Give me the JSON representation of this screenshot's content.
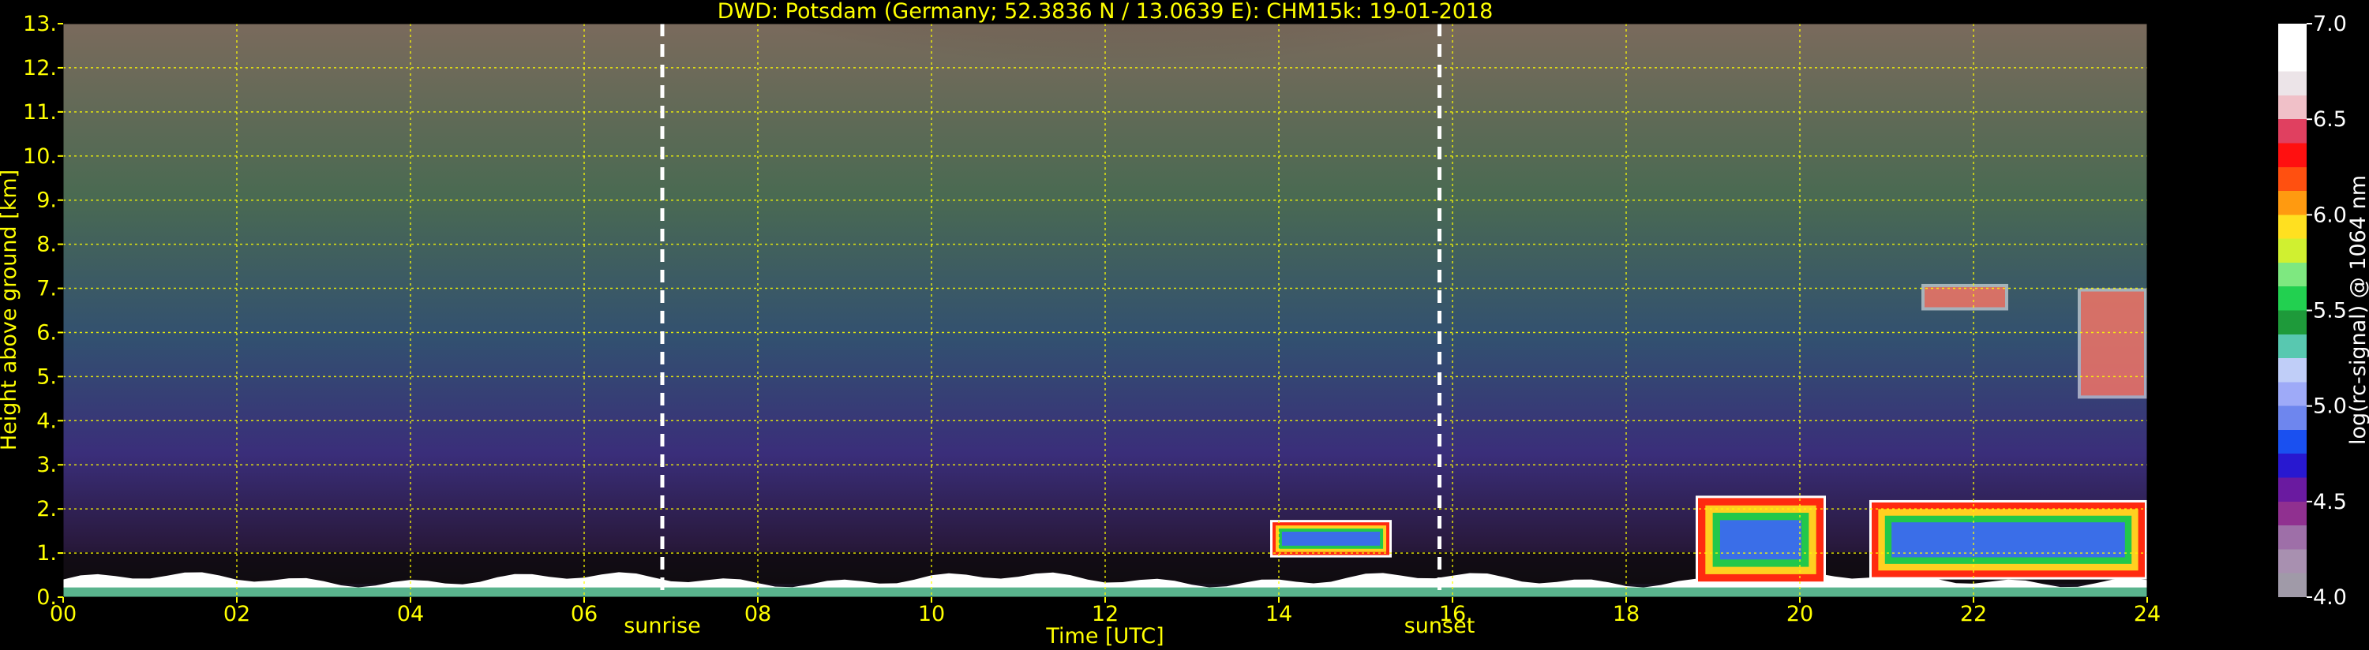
{
  "chart_data": {
    "type": "heatmap",
    "title": "DWD: Potsdam (Germany; 52.3836 N / 13.0639 E):    CHM15k: 19-01-2018",
    "xlabel": "Time [UTC]",
    "ylabel": "Height above ground [km]",
    "xlim": [
      0,
      24
    ],
    "ylim": [
      0,
      13
    ],
    "x_ticks": [
      "00",
      "02",
      "04",
      "06",
      "08",
      "10",
      "12",
      "14",
      "16",
      "18",
      "20",
      "22",
      "24"
    ],
    "y_ticks": [
      "0.",
      "1.",
      "2.",
      "3.",
      "4.",
      "5.",
      "6.",
      "7.",
      "8.",
      "9.",
      "10.",
      "11.",
      "12.",
      "13."
    ],
    "grid": true,
    "grid_color": "#ffff00",
    "markers": [
      {
        "label": "sunrise",
        "time": 6.9
      },
      {
        "label": "sunset",
        "time": 15.85
      }
    ],
    "colorbar": {
      "label": "log(rc-signal) @ 1064 nm",
      "range": [
        4.0,
        7.0
      ],
      "ticks": [
        "4.0",
        "4.5",
        "5.0",
        "5.5",
        "6.0",
        "6.5",
        "7.0"
      ],
      "colors": [
        "#a09aa8",
        "#a890b0",
        "#9e6fa8",
        "#903090",
        "#6a1aa0",
        "#2818d0",
        "#1a50f0",
        "#6e86ee",
        "#9eaaf8",
        "#c0cef8",
        "#58c8b0",
        "#1e9a3a",
        "#22d050",
        "#7ee880",
        "#d0f030",
        "#ffe020",
        "#ff9a10",
        "#ff5010",
        "#ff1010",
        "#e04060",
        "#f0c0c8",
        "#ece4e8",
        "#ffffff",
        "#ffffff"
      ]
    },
    "features": [
      {
        "name": "boundary layer",
        "t": [
          0,
          24
        ],
        "top_km": [
          0.3,
          0.5
        ]
      },
      {
        "name": "cloud",
        "t": [
          13.9,
          15.3
        ],
        "base_km": 0.9,
        "top_km": 1.75
      },
      {
        "name": "cloud",
        "t": [
          18.8,
          20.3
        ],
        "base_km": 0.3,
        "top_km": 2.3
      },
      {
        "name": "cloud",
        "t": [
          20.8,
          24
        ],
        "base_km": 0.4,
        "top_km": 2.2
      },
      {
        "name": "cirrus",
        "t": [
          21.4,
          22.4
        ],
        "base_km": 6.5,
        "top_km": 7.1
      },
      {
        "name": "cirrus",
        "t": [
          23.2,
          24
        ],
        "base_km": 4.5,
        "top_km": 7.0
      }
    ]
  }
}
